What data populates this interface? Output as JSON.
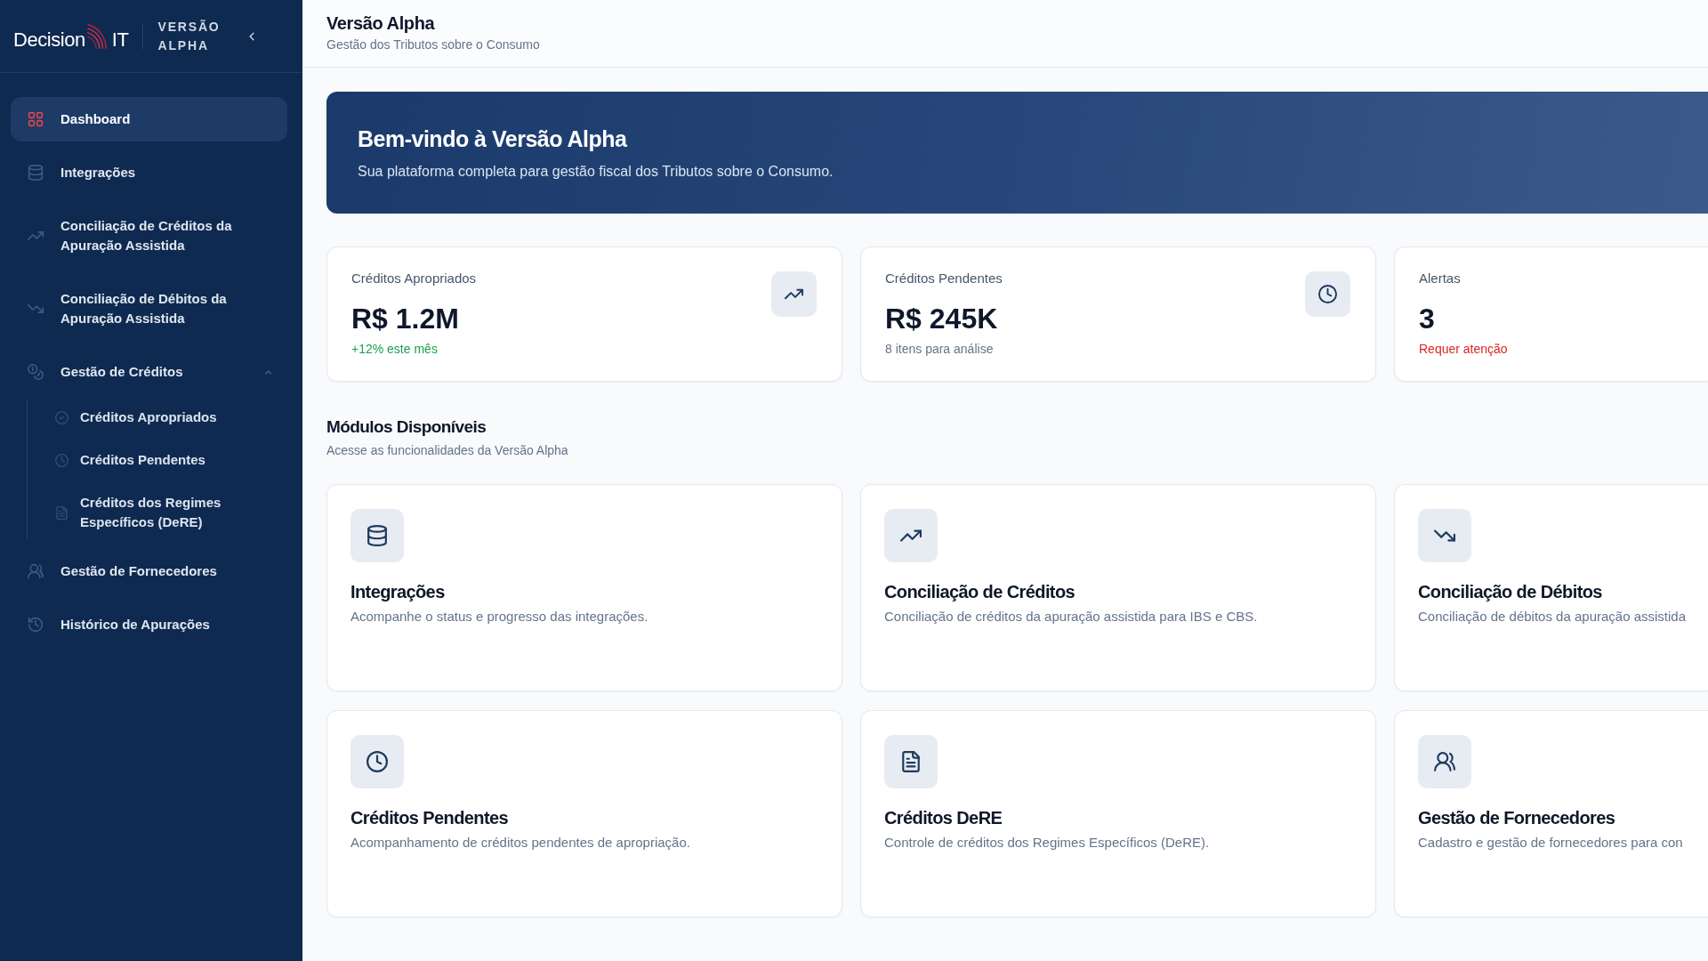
{
  "sidebar": {
    "logo": {
      "word": "Decision",
      "suffix": "IT"
    },
    "edition": "VERSÃO ALPHA",
    "items": [
      {
        "label": "Dashboard",
        "selected": true
      },
      {
        "label": "Integrações",
        "selected": false
      },
      {
        "label": "Conciliação de Créditos da Apuração Assistida",
        "selected": false
      },
      {
        "label": "Conciliação de Débitos da Apuração Assistida",
        "selected": false
      },
      {
        "label": "Gestão de Créditos",
        "selected": false,
        "expanded": true,
        "children": [
          {
            "label": "Créditos Apropriados",
            "selected": false
          },
          {
            "label": "Créditos Pendentes",
            "selected": false
          },
          {
            "label": "Créditos dos Regimes Específicos (DeRE)",
            "selected": false
          }
        ]
      },
      {
        "label": "Gestão de Fornecedores",
        "selected": false
      },
      {
        "label": "Histórico de Apurações",
        "selected": false
      }
    ]
  },
  "header": {
    "title": "Versão Alpha",
    "subtitle": "Gestão dos Tributos sobre o Consumo"
  },
  "banner": {
    "title": "Bem-vindo à Versão Alpha",
    "text": "Sua plataforma completa para gestão fiscal dos Tributos sobre o Consumo."
  },
  "stats": [
    {
      "label": "Créditos Apropriados",
      "value": "R$ 1.2M",
      "note": "+12% este mês",
      "color": "#16a34a"
    },
    {
      "label": "Créditos Pendentes",
      "value": "R$ 245K",
      "note": "8 itens para análise",
      "color": "#64748b"
    },
    {
      "label": "Alertas",
      "value": "3",
      "note": "Requer atenção",
      "color": "#dc2626"
    }
  ],
  "modules_section": {
    "title": "Módulos Disponíveis",
    "subtitle": "Acesse as funcionalidades da Versão Alpha"
  },
  "modules": [
    {
      "title": "Integrações",
      "description": "Acompanhe o status e progresso das integrações."
    },
    {
      "title": "Conciliação de Créditos",
      "description": "Conciliação de créditos da apuração assistida para IBS e CBS."
    },
    {
      "title": "Conciliação de Débitos",
      "description": "Conciliação de débitos da apuração assistida"
    },
    {
      "title": "Créditos Pendentes",
      "description": "Acompanhamento de créditos pendentes de apropriação."
    },
    {
      "title": "Créditos DeRE",
      "description": "Controle de créditos dos Regimes Específicos (DeRE)."
    },
    {
      "title": "Gestão de Fornecedores",
      "description": "Cadastro e gestão de fornecedores para con"
    }
  ]
}
